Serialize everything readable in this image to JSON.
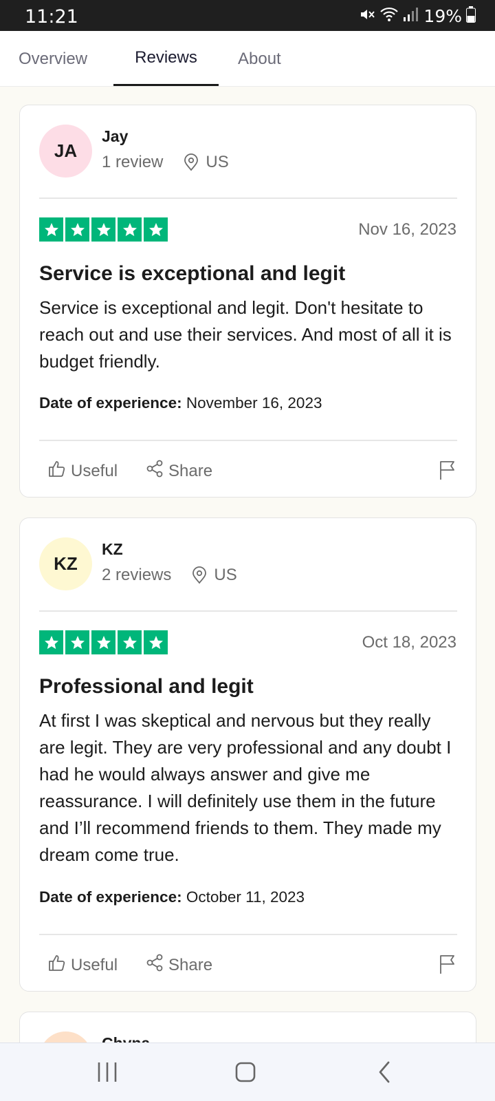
{
  "status_bar": {
    "time": "11:21",
    "battery": "19%",
    "icons": [
      "mute-icon",
      "wifi-icon",
      "signal-icon",
      "battery-icon"
    ]
  },
  "tabs": [
    {
      "label": "Overview",
      "active": false
    },
    {
      "label": "Reviews",
      "active": true
    },
    {
      "label": "About",
      "active": false
    }
  ],
  "reviews": [
    {
      "initials": "JA",
      "avatar_color": "#fddde6",
      "name": "Jay",
      "count": "1 review",
      "country": "US",
      "rating": 5,
      "date": "Nov 16, 2023",
      "title": "Service is exceptional and legit",
      "body": "Service is exceptional and legit. Don't hesitate to reach out and use their services. And most of all it is budget friendly.",
      "experience_label": "Date of experience:",
      "experience_date": "November 16, 2023",
      "useful_label": "Useful",
      "share_label": "Share"
    },
    {
      "initials": "KZ",
      "avatar_color": "#fef8d2",
      "name": "KZ",
      "count": "2 reviews",
      "country": "US",
      "rating": 5,
      "date": "Oct 18, 2023",
      "title": "Professional and legit",
      "body": "At first I was skeptical and nervous but they really are legit. They are very professional and any doubt I had he would always answer and give me reassurance. I will definitely use them in the future and I’ll recommend friends to them. They made my dream come true.",
      "experience_label": "Date of experience:",
      "experience_date": "October 11, 2023",
      "useful_label": "Useful",
      "share_label": "Share"
    },
    {
      "avatar_color": "#fde0c8",
      "name": "Chyna"
    }
  ],
  "colors": {
    "star_green": "#00b67a",
    "page_background": "#fbfaf4",
    "card_background": "#ffffff"
  }
}
